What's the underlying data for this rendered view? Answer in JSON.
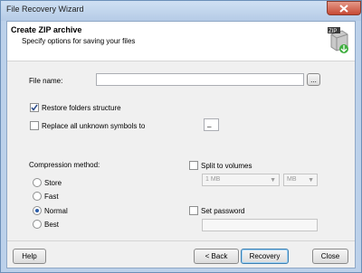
{
  "window": {
    "title": "File Recovery Wizard"
  },
  "header": {
    "title": "Create ZIP archive",
    "subtitle": "Specify options for saving your files"
  },
  "file_name": {
    "label": "File name:",
    "value": "",
    "browse_label": "..."
  },
  "restore_folders": {
    "label": "Restore folders structure",
    "checked": true
  },
  "replace_symbols": {
    "label": "Replace all unknown symbols to",
    "checked": false,
    "symbol": "_"
  },
  "compression": {
    "label": "Compression method:",
    "options": [
      "Store",
      "Fast",
      "Normal",
      "Best"
    ],
    "selected": "Normal"
  },
  "split": {
    "label": "Split to volumes",
    "checked": false,
    "size": "1 MB",
    "unit": "MB"
  },
  "password": {
    "label": "Set password",
    "checked": false,
    "value": ""
  },
  "buttons": {
    "help": "Help",
    "back": "< Back",
    "recovery": "Recovery",
    "close": "Close"
  }
}
